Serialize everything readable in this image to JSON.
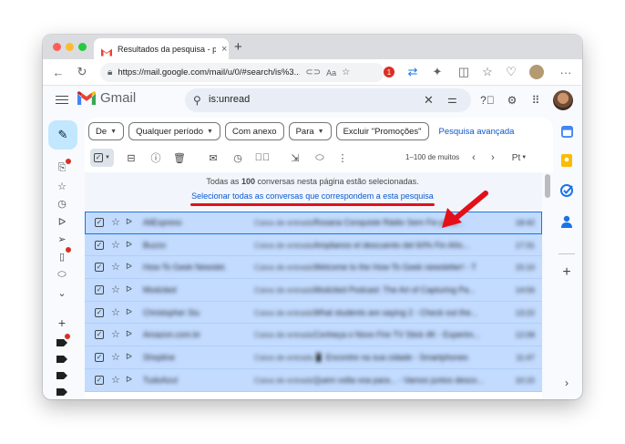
{
  "browser": {
    "tab_title": "Resultados da pesquisa - phil",
    "tab_close": "×",
    "new_tab": "+",
    "url": "https://mail.google.com/mail/u/0/#search/is%3...",
    "ext_badge": "1"
  },
  "gmail": {
    "logo_text": "Gmail",
    "search_query": "is:unread",
    "colors": {
      "accent": "#0b57d0",
      "selected_row": "#c2dbff",
      "compose": "#c2e7ff",
      "annotation": "#e3101a"
    }
  },
  "filters": {
    "chips": [
      {
        "label": "De"
      },
      {
        "label": "Qualquer período"
      },
      {
        "label": "Com anexo"
      },
      {
        "label": "Para"
      },
      {
        "label": "Excluir \"Promoções\""
      }
    ],
    "advanced_link": "Pesquisa avançada"
  },
  "actions": {
    "range": "1–100 de muitos",
    "input_tool": "Pt"
  },
  "banner": {
    "prefix": "Todas as ",
    "count": "100",
    "suffix": " conversas nesta página estão selecionadas.",
    "select_all_link": "Selecionar todas as conversas que correspondem a esta pesquisa"
  },
  "emails": [
    {
      "sender": "AliExpress",
      "label": "Caixa de entrada",
      "subject": "Rosana Conquiste Rádio Sem Fio para...",
      "date": "18:42"
    },
    {
      "sender": "Buzzo",
      "label": "Caixa de entrada",
      "subject": "Amplianos el descuento del 60% Fin Año...",
      "date": "17:31"
    },
    {
      "sender": "How-To Geek Newslet.",
      "label": "Caixa de entrada",
      "subject": "Welcome to the How-To Geek newsletter! - T",
      "date": "15:10"
    },
    {
      "sender": "Modcited",
      "label": "Caixa de entrada",
      "subject": "Modcited Podcast: The Art of Capturing Pa...",
      "date": "14:56"
    },
    {
      "sender": "Christopher Siu",
      "label": "Caixa de entrada",
      "subject": "What students are saying 2 - Check out the...",
      "date": "13:22"
    },
    {
      "sender": "Amazon.com.br",
      "label": "Caixa de entrada",
      "subject": "Conheça o Novo Fire TV Stick 4K - Experim...",
      "date": "12:08"
    },
    {
      "sender": "Shopline",
      "label": "Caixa de entrada",
      "subject": "📱 Encontre na sua cidade - Smartphones",
      "date": "11:47"
    },
    {
      "sender": "TudoAzul",
      "label": "Caixa de entrada",
      "subject": "Quem volta voa para... - Vamos juntos desco...",
      "date": "10:15"
    }
  ]
}
